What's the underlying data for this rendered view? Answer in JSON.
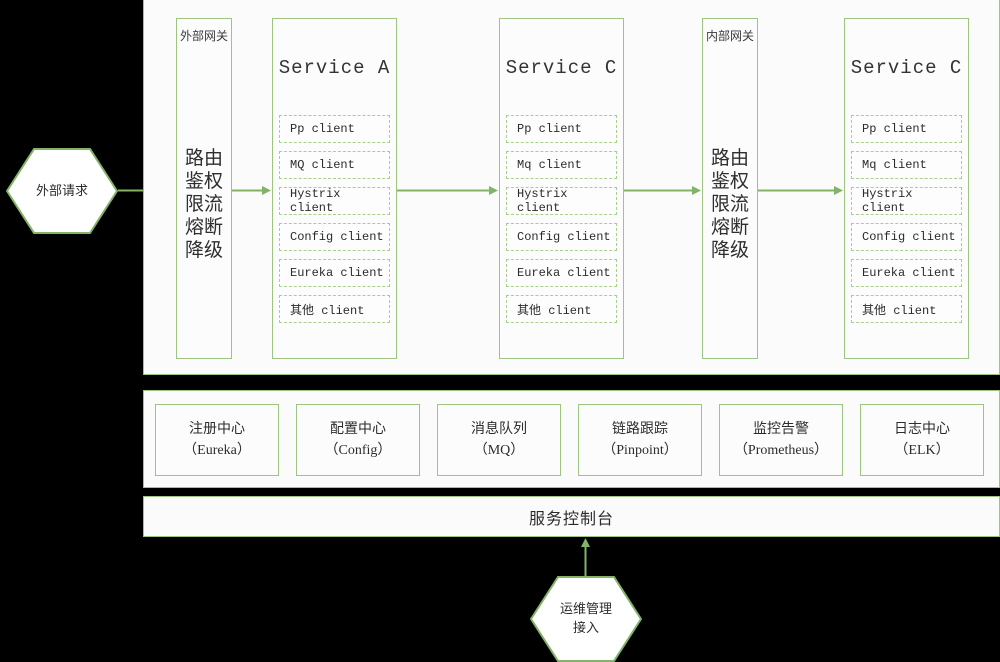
{
  "theme": {
    "background": "#000000",
    "panel_fill": "#fbfbfb",
    "border_green": "#9ec482",
    "arrow_green": "#82b366",
    "dashed_green": "#a9cf8e",
    "text_dark": "#2c2c2c"
  },
  "external_request": {
    "label": "外部请求"
  },
  "columns": [
    {
      "kind": "gateway",
      "name": "external-gateway",
      "title": "外部网关",
      "capability_col_1": [
        "路",
        "鉴",
        "限",
        "熔",
        "降"
      ],
      "capability_col_2": [
        "由",
        "权",
        "流",
        "断",
        "级"
      ]
    },
    {
      "kind": "service",
      "name": "service-a",
      "title": "Service A",
      "clients": [
        "Pp client",
        "MQ client",
        "Hystrix client",
        "Config client",
        "Eureka client",
        "其他 client"
      ]
    },
    {
      "kind": "service",
      "name": "service-c-1",
      "title": "Service C",
      "clients": [
        "Pp client",
        "Mq client",
        "Hystrix client",
        "Config client",
        "Eureka client",
        "其他 client"
      ]
    },
    {
      "kind": "gateway",
      "name": "internal-gateway",
      "title": "内部网关",
      "capability_col_1": [
        "路",
        "鉴",
        "限",
        "熔",
        "降"
      ],
      "capability_col_2": [
        "由",
        "权",
        "流",
        "断",
        "级"
      ]
    },
    {
      "kind": "service",
      "name": "service-c-2",
      "title": "Service C",
      "clients": [
        "Pp client",
        "Mq client",
        "Hystrix client",
        "Config client",
        "Eureka client",
        "其他 client"
      ]
    }
  ],
  "infrastructure": [
    {
      "name": "registry-center",
      "line1": "注册中心",
      "line2": "（Eureka）"
    },
    {
      "name": "config-center",
      "line1": "配置中心",
      "line2": "（Config）"
    },
    {
      "name": "message-queue",
      "line1": "消息队列",
      "line2": "（MQ）"
    },
    {
      "name": "tracing",
      "line1": "链路跟踪",
      "line2": "（Pinpoint）"
    },
    {
      "name": "monitoring-alert",
      "line1": "监控告警",
      "line2": "（Prometheus）"
    },
    {
      "name": "log-center",
      "line1": "日志中心",
      "line2": "（ELK）"
    }
  ],
  "console": {
    "label": "服务控制台"
  },
  "ops_entry": {
    "line1": "运维管理",
    "line2": "接入"
  }
}
